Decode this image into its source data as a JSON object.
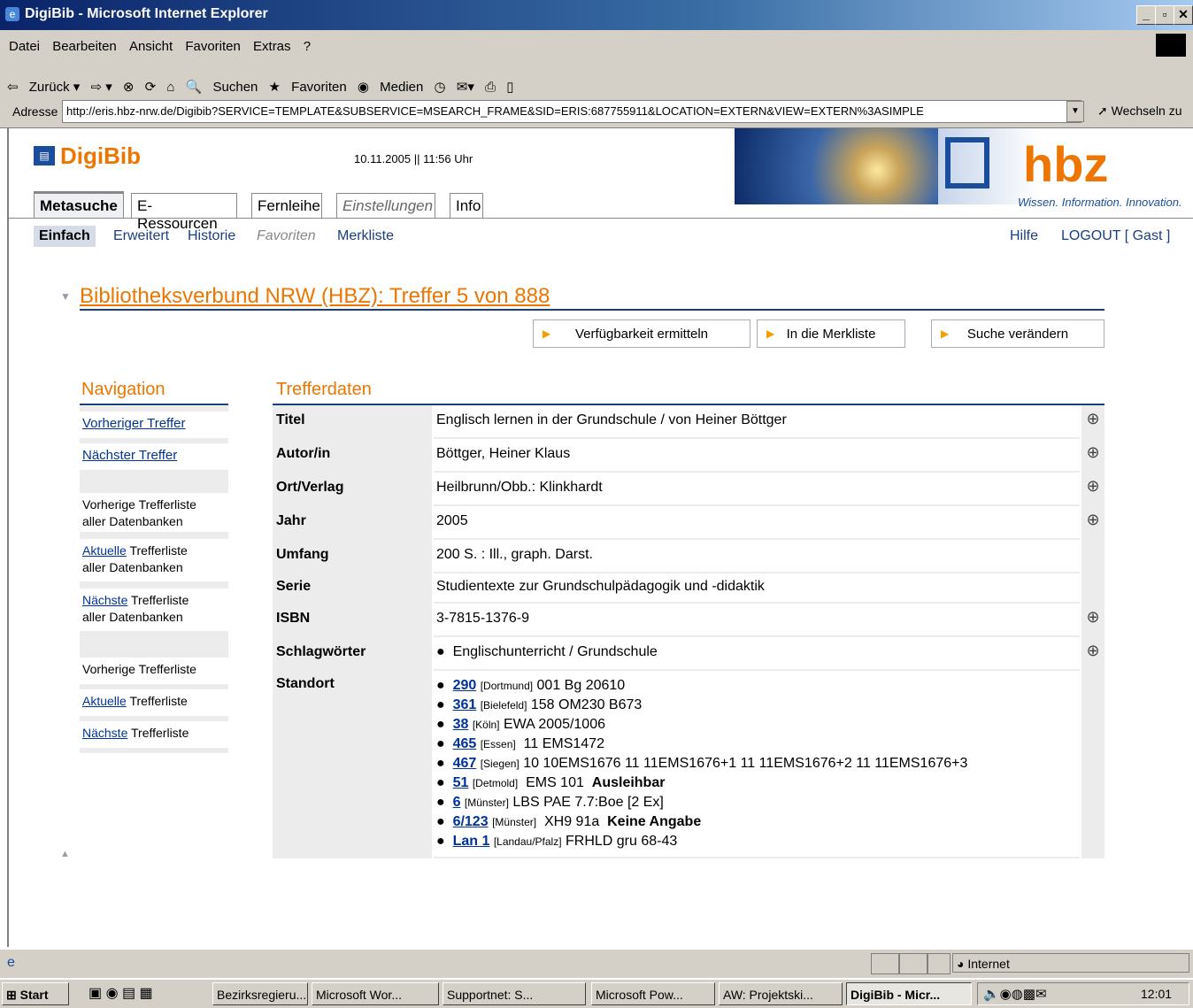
{
  "window": {
    "title": "DigiBib - Microsoft Internet Explorer"
  },
  "menubar": [
    "Datei",
    "Bearbeiten",
    "Ansicht",
    "Favoriten",
    "Extras",
    "?"
  ],
  "toolbar": {
    "back": "Zurück",
    "search": "Suchen",
    "favorites": "Favoriten",
    "media": "Medien"
  },
  "address": {
    "label": "Adresse",
    "url": "http://eris.hbz-nrw.de/Digibib?SERVICE=TEMPLATE&SUBSERVICE=MSEARCH_FRAME&SID=ERIS:687755911&LOCATION=EXTERN&VIEW=EXTERN%3ASIMPLE",
    "go": "Wechseln zu"
  },
  "header": {
    "brand": "DigiBib",
    "datetime": "10.11.2005 || 11:56 Uhr",
    "hbz": "hbz",
    "hbz_tagline": "Wissen. Information. Innovation."
  },
  "tabs": [
    "Metasuche",
    "E-Ressourcen",
    "Fernleihe",
    "Einstellungen",
    "Info"
  ],
  "subnav": [
    "Einfach",
    "Erweitert",
    "Historie",
    "Favoriten",
    "Merkliste"
  ],
  "subnav_right": {
    "help": "Hilfe",
    "logout": "LOGOUT [ Gast ]"
  },
  "heading": "Bibliotheksverbund NRW (HBZ): Treffer 5 von 888",
  "actions": [
    "Verfügbarkeit ermitteln",
    "In die Merkliste",
    "Suche verändern"
  ],
  "navigation": {
    "title": "Navigation",
    "prev": "Vorheriger Treffer",
    "next": "Nächster Treffer",
    "prev_list_all": "Vorherige Trefferliste",
    "all_db": "aller Datenbanken",
    "current": "Aktuelle",
    "next_word": "Nächste",
    "trefferliste": "Trefferliste",
    "prev_list": "Vorherige Trefferliste"
  },
  "details": {
    "title": "Trefferdaten",
    "rows": [
      {
        "label": "Titel",
        "value": "Englisch lernen in der Grundschule / von Heiner Böttger"
      },
      {
        "label": "Autor/in",
        "value": "Böttger, Heiner Klaus"
      },
      {
        "label": "Ort/Verlag",
        "value": "Heilbrunn/Obb.: Klinkhardt"
      },
      {
        "label": "Jahr",
        "value": "2005"
      },
      {
        "label": "Umfang",
        "value": "200 S. : Ill., graph. Darst."
      },
      {
        "label": "Serie",
        "value": "Studientexte zur Grundschulpädagogik und -didaktik"
      },
      {
        "label": "ISBN",
        "value": "3-7815-1376-9"
      },
      {
        "label": "Schlagwörter",
        "value": "Englischunterricht / Grundschule"
      },
      {
        "label": "Standort",
        "value": ""
      }
    ],
    "standorte": [
      {
        "code": "290",
        "place": "[Dortmund]",
        "text": "001 Bg 20610",
        "status": ""
      },
      {
        "code": "361",
        "place": "[Bielefeld]",
        "text": "158 OM230 B673",
        "status": ""
      },
      {
        "code": "38",
        "place": "[Köln]",
        "text": "EWA 2005/1006",
        "status": ""
      },
      {
        "code": "465",
        "place": "[Essen]",
        "text": "11 EMS1472",
        "status": ""
      },
      {
        "code": "467",
        "place": "[Siegen]",
        "text": "10 10EMS1676  11 11EMS1676+1  11 11EMS1676+2  11 11EMS1676+3",
        "status": ""
      },
      {
        "code": "51",
        "place": "[Detmold]",
        "text": "EMS 101",
        "status": "Ausleihbar"
      },
      {
        "code": "6",
        "place": "[Münster]",
        "text": "LBS PAE 7.7:Boe [2 Ex]",
        "status": ""
      },
      {
        "code": "6/123",
        "place": "[Münster]",
        "text": "XH9 91a",
        "status": "Keine Angabe"
      },
      {
        "code": "Lan 1",
        "place": "[Landau/Pfalz]",
        "text": "FRHLD gru 68-43",
        "status": ""
      }
    ]
  },
  "statusbar": {
    "zone": "Internet"
  },
  "taskbar": {
    "start": "Start",
    "tasks": [
      "Bezirksregieru...",
      "Microsoft Wor...",
      "Supportnet: S...",
      "Microsoft Pow...",
      "AW: Projektski...",
      "DigiBib - Micr..."
    ],
    "clock": "12:01"
  }
}
